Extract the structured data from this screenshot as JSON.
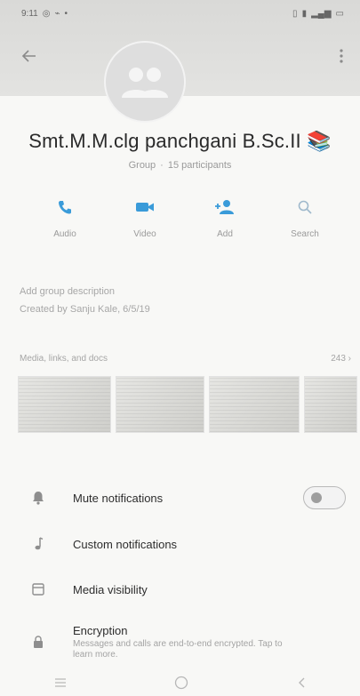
{
  "status_bar": {
    "time": "9:11",
    "left_icons": [
      "whatsapp-icon",
      "signal-icon",
      "wifi-icon"
    ],
    "right_icons": [
      "vibrate-icon",
      "volte-icon",
      "signal-bars-icon",
      "battery-icon"
    ]
  },
  "header": {
    "back_icon": "arrow-left-icon",
    "more_icon": "more-vertical-icon",
    "avatar_icon": "group-avatar-icon"
  },
  "group": {
    "name": "Smt.M.M.clg  panchgani B.Sc.II 📚",
    "type_label": "Group",
    "participants": "15 participants"
  },
  "actions": [
    {
      "label": "Audio",
      "icon": "phone-icon"
    },
    {
      "label": "Video",
      "icon": "video-icon"
    },
    {
      "label": "Add",
      "icon": "add-person-icon"
    },
    {
      "label": "Search",
      "icon": "search-icon"
    }
  ],
  "description": {
    "add_label": "Add group description",
    "created_by": "Created by Sanju Kale, 6/5/19"
  },
  "media": {
    "label": "Media, links, and docs",
    "count": "243 ›",
    "thumbnails": 4
  },
  "settings": [
    {
      "label": "Mute notifications",
      "icon": "bell-icon",
      "toggle": true,
      "sub": ""
    },
    {
      "label": "Custom notifications",
      "icon": "music-note-icon",
      "toggle": false,
      "sub": ""
    },
    {
      "label": "Media visibility",
      "icon": "image-icon",
      "toggle": false,
      "sub": ""
    },
    {
      "label": "Encryption",
      "icon": "lock-icon",
      "toggle": false,
      "sub": "Messages and calls are end-to-end encrypted. Tap to learn more."
    }
  ],
  "nav": {
    "recents_icon": "recents-icon",
    "home_icon": "home-circle-icon",
    "back_icon": "back-chevron-icon"
  },
  "colors": {
    "accent_icon": "#3a9bd9",
    "header_bg": "#dcdcda",
    "toggle_off": "#9e9e9e"
  }
}
